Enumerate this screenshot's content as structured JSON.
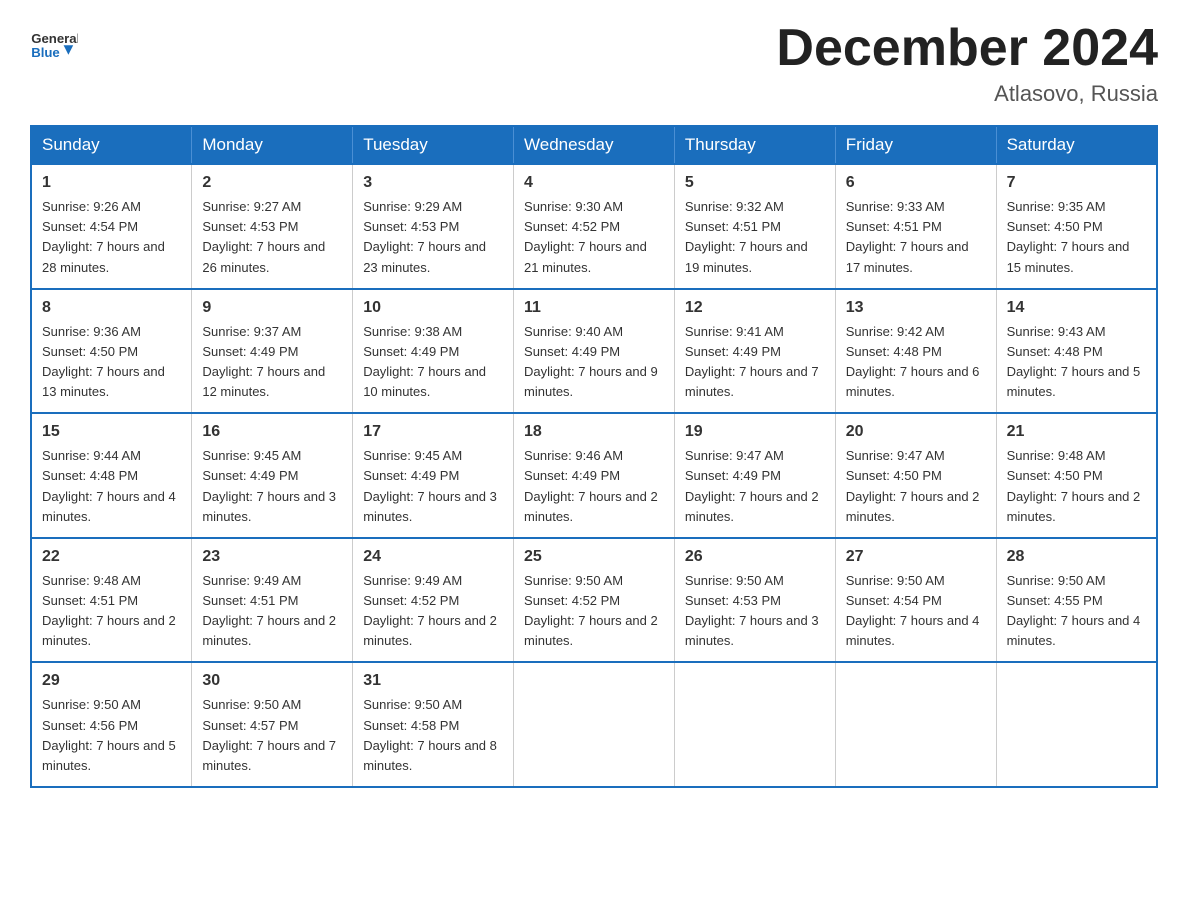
{
  "header": {
    "logo_line1": "General",
    "logo_line2": "Blue",
    "month_title": "December 2024",
    "location": "Atlasovo, Russia"
  },
  "days_of_week": [
    "Sunday",
    "Monday",
    "Tuesday",
    "Wednesday",
    "Thursday",
    "Friday",
    "Saturday"
  ],
  "weeks": [
    [
      {
        "day": "1",
        "sunrise": "9:26 AM",
        "sunset": "4:54 PM",
        "daylight": "7 hours and 28 minutes."
      },
      {
        "day": "2",
        "sunrise": "9:27 AM",
        "sunset": "4:53 PM",
        "daylight": "7 hours and 26 minutes."
      },
      {
        "day": "3",
        "sunrise": "9:29 AM",
        "sunset": "4:53 PM",
        "daylight": "7 hours and 23 minutes."
      },
      {
        "day": "4",
        "sunrise": "9:30 AM",
        "sunset": "4:52 PM",
        "daylight": "7 hours and 21 minutes."
      },
      {
        "day": "5",
        "sunrise": "9:32 AM",
        "sunset": "4:51 PM",
        "daylight": "7 hours and 19 minutes."
      },
      {
        "day": "6",
        "sunrise": "9:33 AM",
        "sunset": "4:51 PM",
        "daylight": "7 hours and 17 minutes."
      },
      {
        "day": "7",
        "sunrise": "9:35 AM",
        "sunset": "4:50 PM",
        "daylight": "7 hours and 15 minutes."
      }
    ],
    [
      {
        "day": "8",
        "sunrise": "9:36 AM",
        "sunset": "4:50 PM",
        "daylight": "7 hours and 13 minutes."
      },
      {
        "day": "9",
        "sunrise": "9:37 AM",
        "sunset": "4:49 PM",
        "daylight": "7 hours and 12 minutes."
      },
      {
        "day": "10",
        "sunrise": "9:38 AM",
        "sunset": "4:49 PM",
        "daylight": "7 hours and 10 minutes."
      },
      {
        "day": "11",
        "sunrise": "9:40 AM",
        "sunset": "4:49 PM",
        "daylight": "7 hours and 9 minutes."
      },
      {
        "day": "12",
        "sunrise": "9:41 AM",
        "sunset": "4:49 PM",
        "daylight": "7 hours and 7 minutes."
      },
      {
        "day": "13",
        "sunrise": "9:42 AM",
        "sunset": "4:48 PM",
        "daylight": "7 hours and 6 minutes."
      },
      {
        "day": "14",
        "sunrise": "9:43 AM",
        "sunset": "4:48 PM",
        "daylight": "7 hours and 5 minutes."
      }
    ],
    [
      {
        "day": "15",
        "sunrise": "9:44 AM",
        "sunset": "4:48 PM",
        "daylight": "7 hours and 4 minutes."
      },
      {
        "day": "16",
        "sunrise": "9:45 AM",
        "sunset": "4:49 PM",
        "daylight": "7 hours and 3 minutes."
      },
      {
        "day": "17",
        "sunrise": "9:45 AM",
        "sunset": "4:49 PM",
        "daylight": "7 hours and 3 minutes."
      },
      {
        "day": "18",
        "sunrise": "9:46 AM",
        "sunset": "4:49 PM",
        "daylight": "7 hours and 2 minutes."
      },
      {
        "day": "19",
        "sunrise": "9:47 AM",
        "sunset": "4:49 PM",
        "daylight": "7 hours and 2 minutes."
      },
      {
        "day": "20",
        "sunrise": "9:47 AM",
        "sunset": "4:50 PM",
        "daylight": "7 hours and 2 minutes."
      },
      {
        "day": "21",
        "sunrise": "9:48 AM",
        "sunset": "4:50 PM",
        "daylight": "7 hours and 2 minutes."
      }
    ],
    [
      {
        "day": "22",
        "sunrise": "9:48 AM",
        "sunset": "4:51 PM",
        "daylight": "7 hours and 2 minutes."
      },
      {
        "day": "23",
        "sunrise": "9:49 AM",
        "sunset": "4:51 PM",
        "daylight": "7 hours and 2 minutes."
      },
      {
        "day": "24",
        "sunrise": "9:49 AM",
        "sunset": "4:52 PM",
        "daylight": "7 hours and 2 minutes."
      },
      {
        "day": "25",
        "sunrise": "9:50 AM",
        "sunset": "4:52 PM",
        "daylight": "7 hours and 2 minutes."
      },
      {
        "day": "26",
        "sunrise": "9:50 AM",
        "sunset": "4:53 PM",
        "daylight": "7 hours and 3 minutes."
      },
      {
        "day": "27",
        "sunrise": "9:50 AM",
        "sunset": "4:54 PM",
        "daylight": "7 hours and 4 minutes."
      },
      {
        "day": "28",
        "sunrise": "9:50 AM",
        "sunset": "4:55 PM",
        "daylight": "7 hours and 4 minutes."
      }
    ],
    [
      {
        "day": "29",
        "sunrise": "9:50 AM",
        "sunset": "4:56 PM",
        "daylight": "7 hours and 5 minutes."
      },
      {
        "day": "30",
        "sunrise": "9:50 AM",
        "sunset": "4:57 PM",
        "daylight": "7 hours and 7 minutes."
      },
      {
        "day": "31",
        "sunrise": "9:50 AM",
        "sunset": "4:58 PM",
        "daylight": "7 hours and 8 minutes."
      },
      null,
      null,
      null,
      null
    ]
  ]
}
